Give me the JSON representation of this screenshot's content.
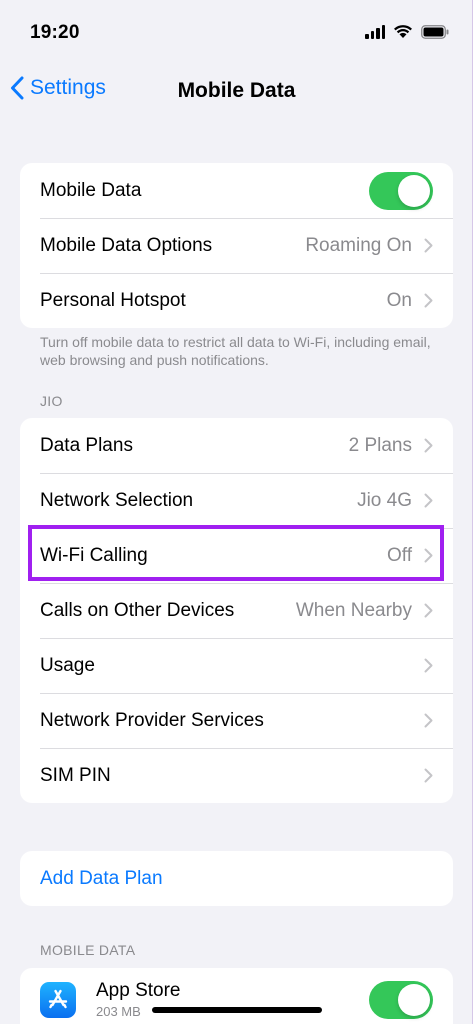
{
  "status_bar": {
    "time": "19:20",
    "icons": [
      "signal-icon",
      "wifi-icon",
      "battery-icon"
    ]
  },
  "nav": {
    "back_label": "Settings",
    "title": "Mobile Data"
  },
  "group_main": {
    "rows": [
      {
        "label": "Mobile Data",
        "toggle": true
      },
      {
        "label": "Mobile Data Options",
        "value": "Roaming On"
      },
      {
        "label": "Personal Hotspot",
        "value": "On"
      }
    ],
    "footer": "Turn off mobile data to restrict all data to Wi-Fi, including email, web browsing and push notifications."
  },
  "group_carrier": {
    "header": "JIO",
    "rows": [
      {
        "label": "Data Plans",
        "value": "2 Plans"
      },
      {
        "label": "Network Selection",
        "value": "Jio 4G"
      },
      {
        "label": "Wi-Fi Calling",
        "value": "Off",
        "highlighted": true
      },
      {
        "label": "Calls on Other Devices",
        "value": "When Nearby"
      },
      {
        "label": "Usage",
        "value": ""
      },
      {
        "label": "Network Provider Services",
        "value": ""
      },
      {
        "label": "SIM PIN",
        "value": ""
      }
    ]
  },
  "group_add": {
    "link_label": "Add Data Plan"
  },
  "group_apps": {
    "header": "MOBILE DATA",
    "apps": [
      {
        "name": "App Store",
        "size": "203 MB",
        "toggle": true
      }
    ]
  },
  "colors": {
    "accent": "#0a7aff",
    "toggle_on": "#34c759",
    "highlight": "#a020f0",
    "background": "#f2f2f7",
    "secondary_text": "#8a8a8e"
  }
}
